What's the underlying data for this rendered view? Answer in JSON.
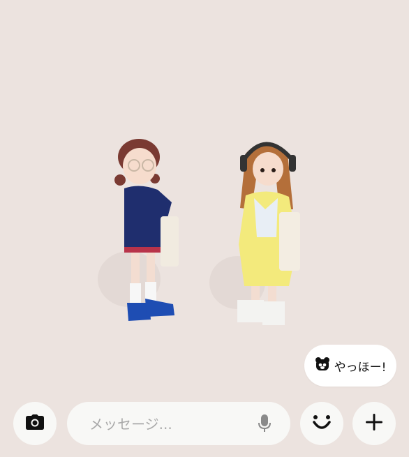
{
  "quick_reply": {
    "label": "やっほー!",
    "icon": "bear-emoji-icon"
  },
  "composer": {
    "placeholder": "メッセージ...",
    "camera_icon": "camera-icon",
    "mic_icon": "microphone-icon",
    "emoji_icon": "smile-icon",
    "add_icon": "plus-icon"
  },
  "colors": {
    "background": "#ece3df",
    "button_bg": "#f8f8f6",
    "icon": "#111111",
    "placeholder": "#a9a9a9"
  }
}
